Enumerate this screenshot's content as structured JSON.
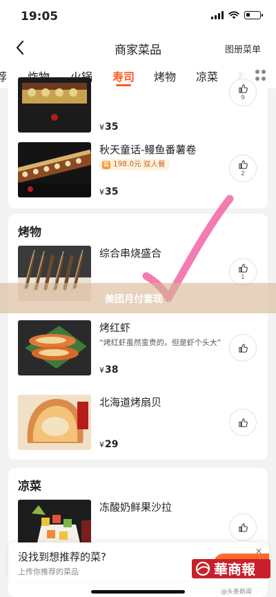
{
  "status_bar": {
    "time": "19:05"
  },
  "nav": {
    "title": "商家菜品",
    "right_label": "图册菜单"
  },
  "tabs": [
    {
      "label": "荐"
    },
    {
      "label": "炸物"
    },
    {
      "label": "火锅"
    },
    {
      "label": "寿司",
      "active": true
    },
    {
      "label": "烤物"
    },
    {
      "label": "凉菜"
    },
    {
      "label": "甜"
    }
  ],
  "sushi_section": {
    "items": [
      {
        "name": "",
        "price": "35",
        "likes": "9"
      },
      {
        "name": "秋天童话-鳗鱼番薯卷",
        "badge": "198.0元 双人餐",
        "price": "35",
        "likes": "2"
      }
    ]
  },
  "grill_section": {
    "title": "烤物",
    "items": [
      {
        "name": "综合串烧盛合",
        "likes": "1"
      },
      {
        "name": "烤红虾",
        "desc": "“烤红虾虽然蛮贵的，但是虾个头大”",
        "price": "38"
      },
      {
        "name": "北海道烤扇贝",
        "price": "29"
      }
    ]
  },
  "cold_section": {
    "title": "凉菜",
    "items": [
      {
        "name": "冻酸奶鲜果沙拉"
      }
    ]
  },
  "overlay": {
    "text": "美团月付套现"
  },
  "banner": {
    "title": "没找到想推荐的菜?",
    "subtitle": "上传你推荐的菜品"
  },
  "watermark": {
    "logo_text": "華商報",
    "source": "@头条新闻"
  },
  "currency_symbol": "¥",
  "colors": {
    "accent": "#ff5a1f",
    "checkmark": "#f06aa6",
    "overlay": "#d6b694"
  }
}
